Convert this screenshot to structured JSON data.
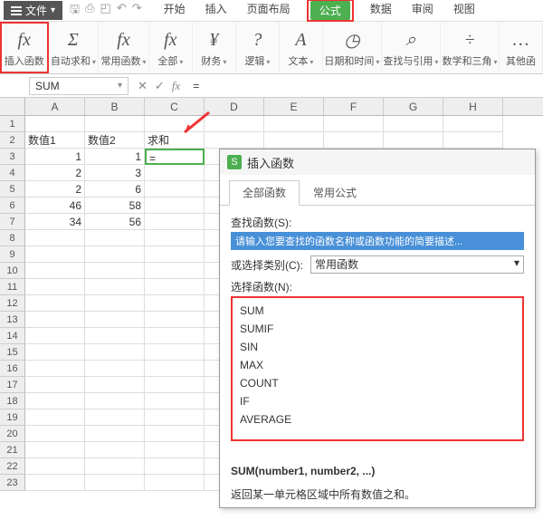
{
  "menubar": {
    "file_label": "文件",
    "tabs": [
      "开始",
      "插入",
      "页面布局",
      "公式",
      "数据",
      "审阅",
      "视图"
    ],
    "active_tab_index": 3
  },
  "qat_icons": [
    "save-icon",
    "print-icon",
    "preview-icon",
    "undo-icon",
    "redo-icon"
  ],
  "ribbon": {
    "groups": [
      {
        "icon": "fx",
        "label": "插入函数",
        "dd": false,
        "hl": true
      },
      {
        "icon": "Σ",
        "label": "自动求和",
        "dd": true
      },
      {
        "icon": "fx",
        "label": "常用函数",
        "dd": true
      },
      {
        "icon": "fx",
        "label": "全部",
        "dd": true
      },
      {
        "icon": "¥",
        "label": "财务",
        "dd": true
      },
      {
        "icon": "?",
        "label": "逻辑",
        "dd": true
      },
      {
        "icon": "A",
        "label": "文本",
        "dd": true
      },
      {
        "icon": "◷",
        "label": "日期和时间",
        "dd": true
      },
      {
        "icon": "⌕",
        "label": "查找与引用",
        "dd": true
      },
      {
        "icon": "÷",
        "label": "数学和三角",
        "dd": true
      },
      {
        "icon": "…",
        "label": "其他函",
        "dd": true
      }
    ]
  },
  "formula_bar": {
    "name": "SUM",
    "content": "="
  },
  "grid": {
    "cols": [
      "A",
      "B",
      "C",
      "D",
      "E",
      "F",
      "G",
      "H"
    ],
    "row_count": 23,
    "headers": {
      "A": "数值1",
      "B": "数值2",
      "C": "求和"
    },
    "data": [
      {
        "A": 1,
        "B": 1,
        "C": "="
      },
      {
        "A": 2,
        "B": 3
      },
      {
        "A": 2,
        "B": 6
      },
      {
        "A": 46,
        "B": 58
      },
      {
        "A": 34,
        "B": 56
      }
    ],
    "active_cell": "C3"
  },
  "dialog": {
    "title": "插入函数",
    "tabs": [
      "全部函数",
      "常用公式"
    ],
    "active_tab": 0,
    "search_label": "查找函数(S):",
    "search_placeholder": "请输入您要查找的函数名称或函数功能的简要描述...",
    "category_label": "或选择类别(C):",
    "category_value": "常用函数",
    "select_label": "选择函数(N):",
    "functions": [
      "SUM",
      "SUMIF",
      "SIN",
      "MAX",
      "COUNT",
      "IF",
      "AVERAGE"
    ],
    "signature": "SUM(number1, number2, ...)",
    "description": "返回某一单元格区域中所有数值之和。"
  }
}
